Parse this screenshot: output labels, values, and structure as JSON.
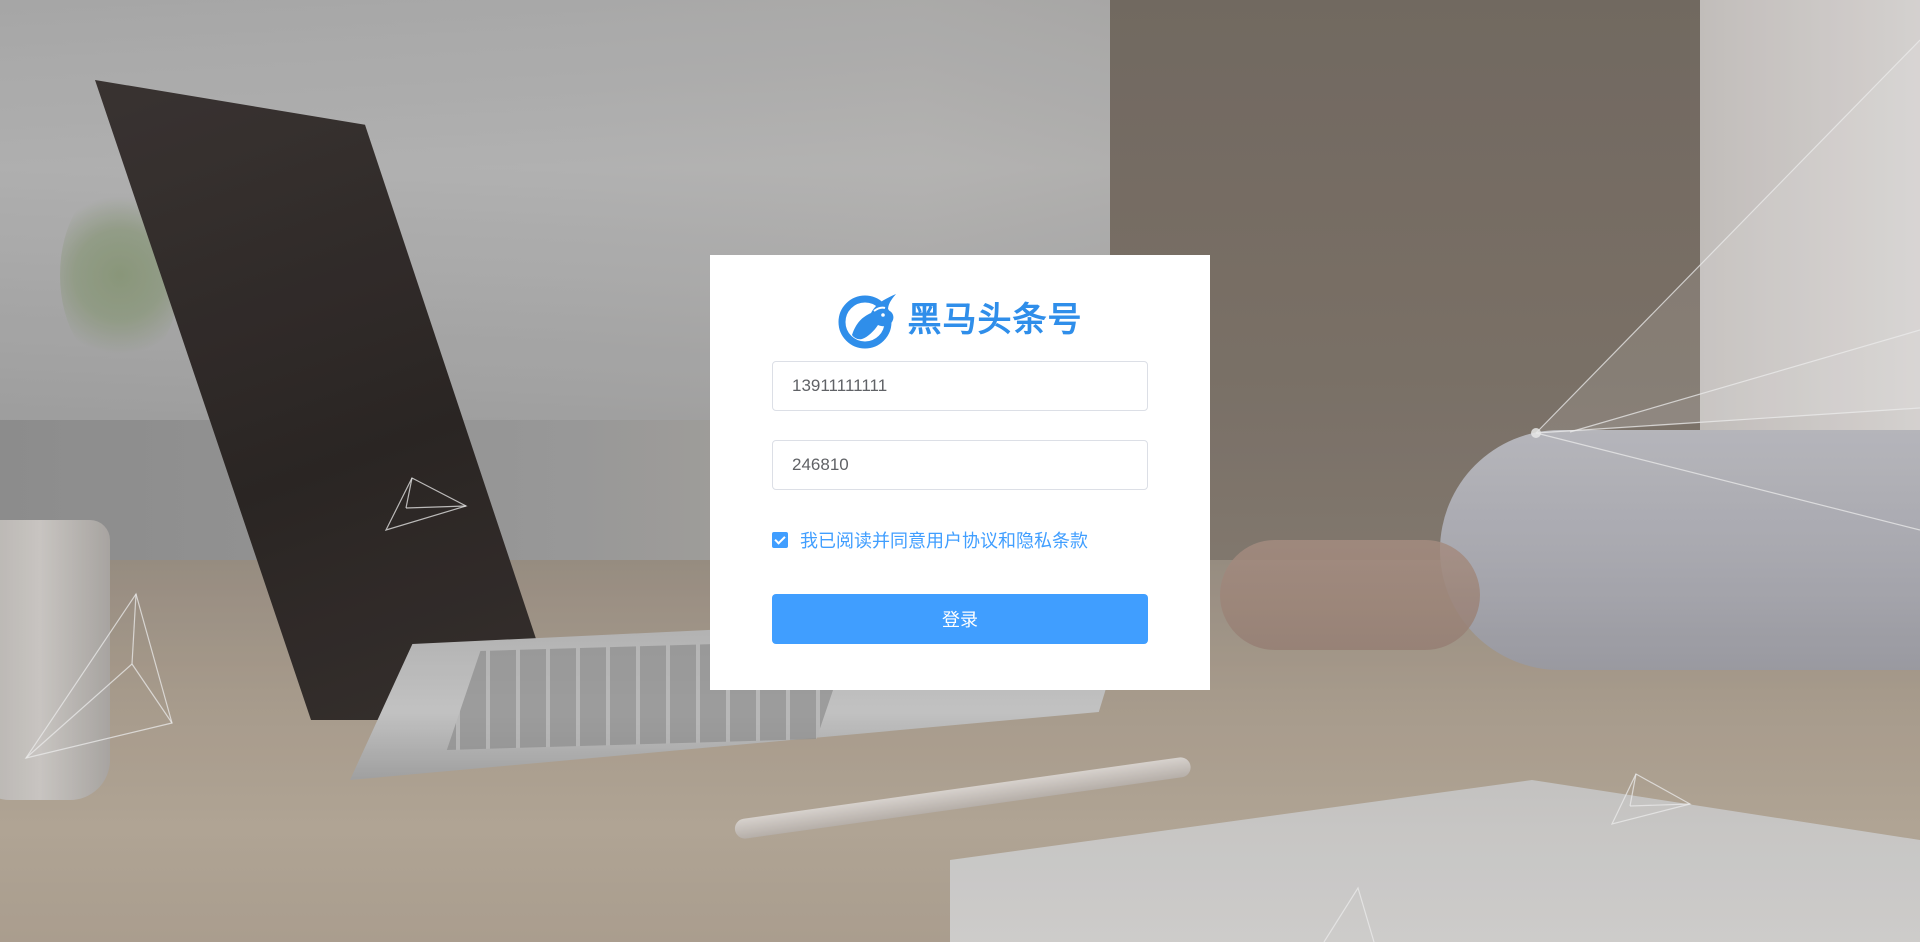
{
  "brand": {
    "name": "黑马头条号",
    "logo_icon": "horse-head-logo-icon",
    "color": "#2f8eea"
  },
  "form": {
    "mobile": {
      "value": "13911111111",
      "placeholder": ""
    },
    "code": {
      "value": "246810",
      "placeholder": ""
    },
    "agree": {
      "checked": true,
      "label": "我已阅读并同意用户协议和隐私条款"
    },
    "submit_label": "登录"
  },
  "colors": {
    "accent": "#409eff",
    "card_background": "#ffffff",
    "input_border": "#dcdfe6"
  }
}
